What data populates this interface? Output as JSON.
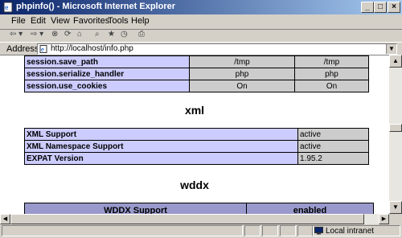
{
  "window": {
    "title": "phpinfo() - Microsoft Internet Explorer"
  },
  "menu": {
    "items": [
      "File",
      "Edit",
      "View",
      "Favorites",
      "Tools",
      "Help"
    ]
  },
  "address": {
    "label": "Address",
    "url": "http://localhost/info.php"
  },
  "session_table": [
    {
      "key": "session.save_path",
      "local": "/tmp",
      "master": "/tmp"
    },
    {
      "key": "session.serialize_handler",
      "local": "php",
      "master": "php"
    },
    {
      "key": "session.use_cookies",
      "local": "On",
      "master": "On"
    }
  ],
  "xml": {
    "title": "xml",
    "rows": [
      {
        "key": "XML Support",
        "value": "active"
      },
      {
        "key": "XML Namespace Support",
        "value": "active"
      },
      {
        "key": "EXPAT Version",
        "value": "1.95.2"
      }
    ]
  },
  "wddx": {
    "title": "wddx",
    "header": {
      "left": "WDDX Support",
      "right": "enabled"
    }
  },
  "status": {
    "zone": "Local intranet"
  },
  "colors": {
    "row_key": "#ccccff",
    "row_value": "#cccccc",
    "header": "#9999cc"
  }
}
